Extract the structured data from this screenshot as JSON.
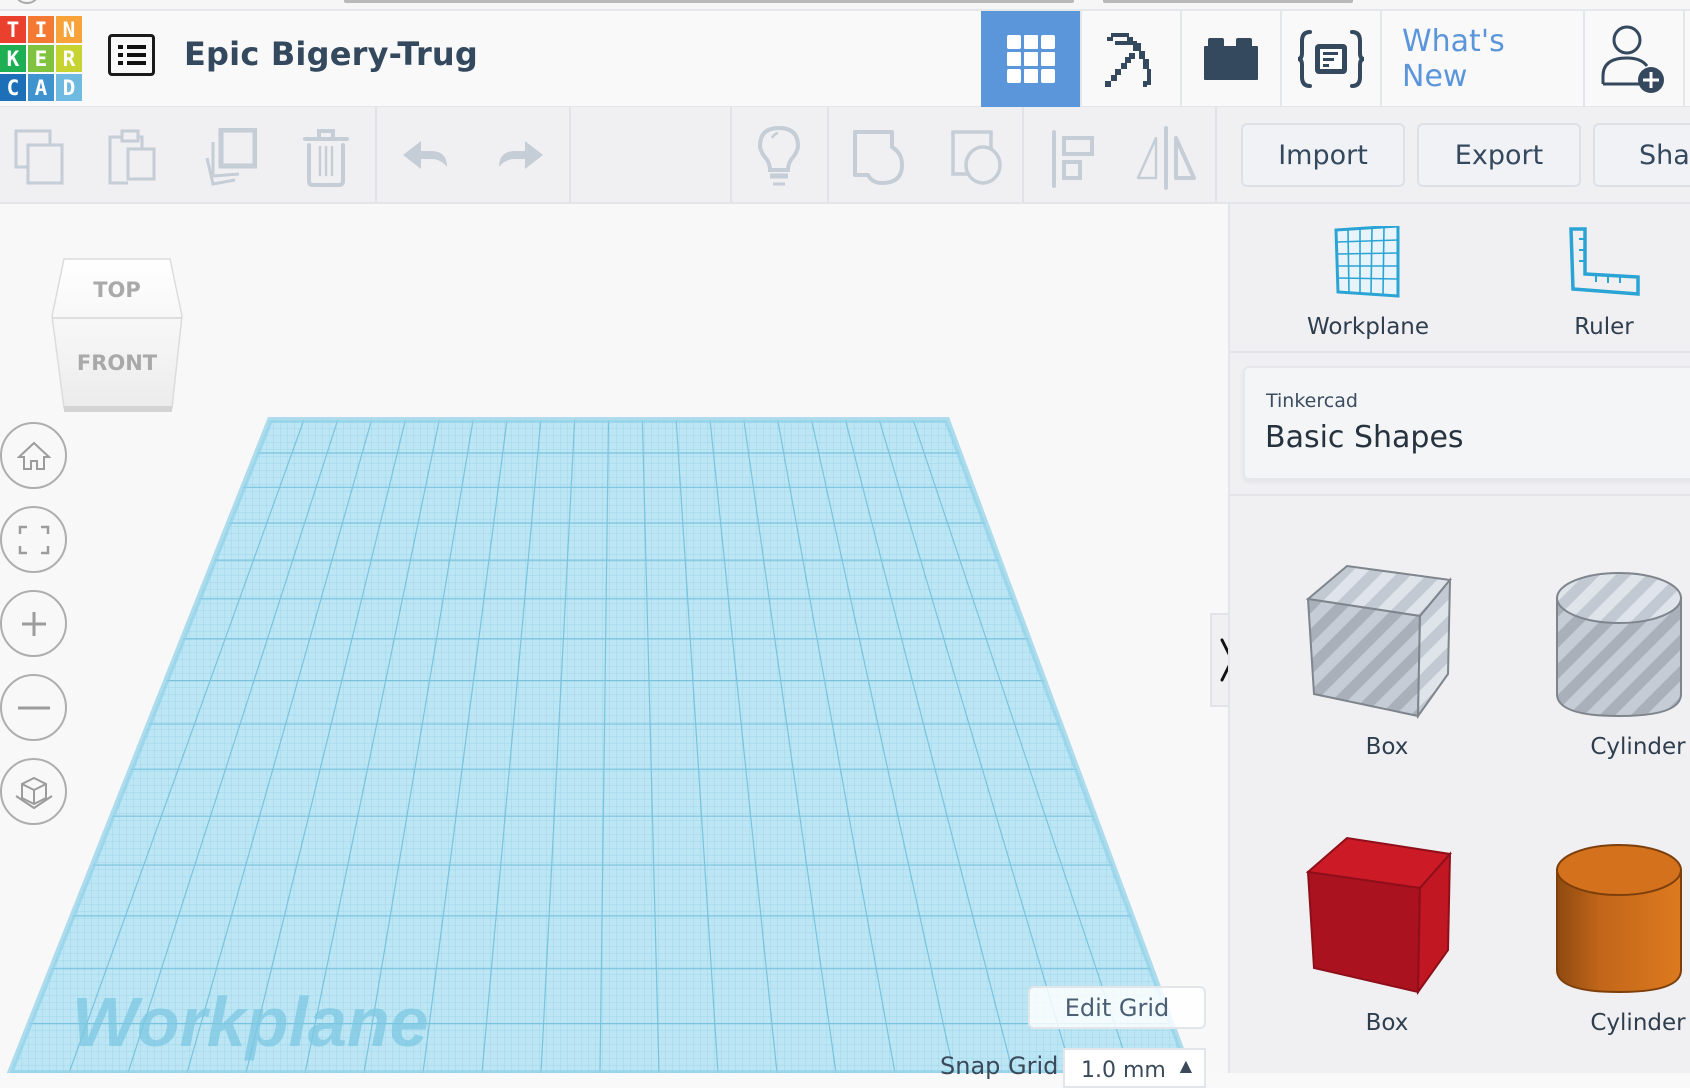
{
  "app": {
    "logo_letters": [
      "T",
      "I",
      "N",
      "K",
      "E",
      "R",
      "C",
      "A",
      "D"
    ],
    "logo_colors": [
      "#e9412d",
      "#f47a34",
      "#f8a33a",
      "#1eae53",
      "#7fc341",
      "#c7d331",
      "#1d6fb8",
      "#3f94d0",
      "#6ebae0"
    ],
    "project_title": "Epic Bigery-Trug"
  },
  "topbar": {
    "buttons": [
      {
        "name": "3d-design-view",
        "icon": "grid-icon",
        "active": true
      },
      {
        "name": "blocks-view",
        "icon": "pickaxe-icon",
        "active": false
      },
      {
        "name": "bricks-view",
        "icon": "brick-icon",
        "active": false
      },
      {
        "name": "codeblocks-view",
        "icon": "codeblocks-icon",
        "active": false
      }
    ],
    "whats_new": "What's New",
    "invite_icon": "add-user-icon",
    "accent_color": "#5b96da"
  },
  "toolbar": {
    "tools": [
      {
        "name": "copy",
        "icon": "copy-icon"
      },
      {
        "name": "paste",
        "icon": "paste-icon"
      },
      {
        "name": "duplicate",
        "icon": "duplicate-icon"
      },
      {
        "name": "delete",
        "icon": "trash-icon"
      },
      {
        "name": "undo",
        "icon": "undo-icon"
      },
      {
        "name": "redo",
        "icon": "redo-icon"
      },
      {
        "name": "notes",
        "icon": "lightbulb-icon"
      },
      {
        "name": "group",
        "icon": "group-icon"
      },
      {
        "name": "ungroup",
        "icon": "ungroup-icon"
      },
      {
        "name": "align",
        "icon": "align-icon"
      },
      {
        "name": "mirror",
        "icon": "mirror-icon"
      }
    ],
    "import_label": "Import",
    "export_label": "Export",
    "share_label": "Share"
  },
  "viewport": {
    "viewcube": {
      "top": "TOP",
      "front": "FRONT"
    },
    "nav_buttons": [
      "home-view",
      "fit-all",
      "zoom-in",
      "zoom-out",
      "ortho-toggle"
    ],
    "workplane_label": "Workplane",
    "edit_grid_label": "Edit Grid",
    "snap_grid_label": "Snap Grid",
    "snap_grid_value": "1.0 mm",
    "grid_color": "#b7e3f2"
  },
  "panel": {
    "tools": [
      {
        "label": "Workplane",
        "icon": "workplane-icon"
      },
      {
        "label": "Ruler",
        "icon": "ruler-icon"
      }
    ],
    "library": {
      "source": "Tinkercad",
      "name": "Basic Shapes"
    },
    "shapes": [
      {
        "label": "Box",
        "kind": "box-hole",
        "color": "#b9c0ca"
      },
      {
        "label": "Cylinder",
        "kind": "cylinder-hole",
        "color": "#b9c0ca"
      },
      {
        "label": "Box",
        "kind": "box",
        "color": "#c81a27"
      },
      {
        "label": "Cylinder",
        "kind": "cylinder",
        "color": "#d8721b"
      }
    ]
  }
}
